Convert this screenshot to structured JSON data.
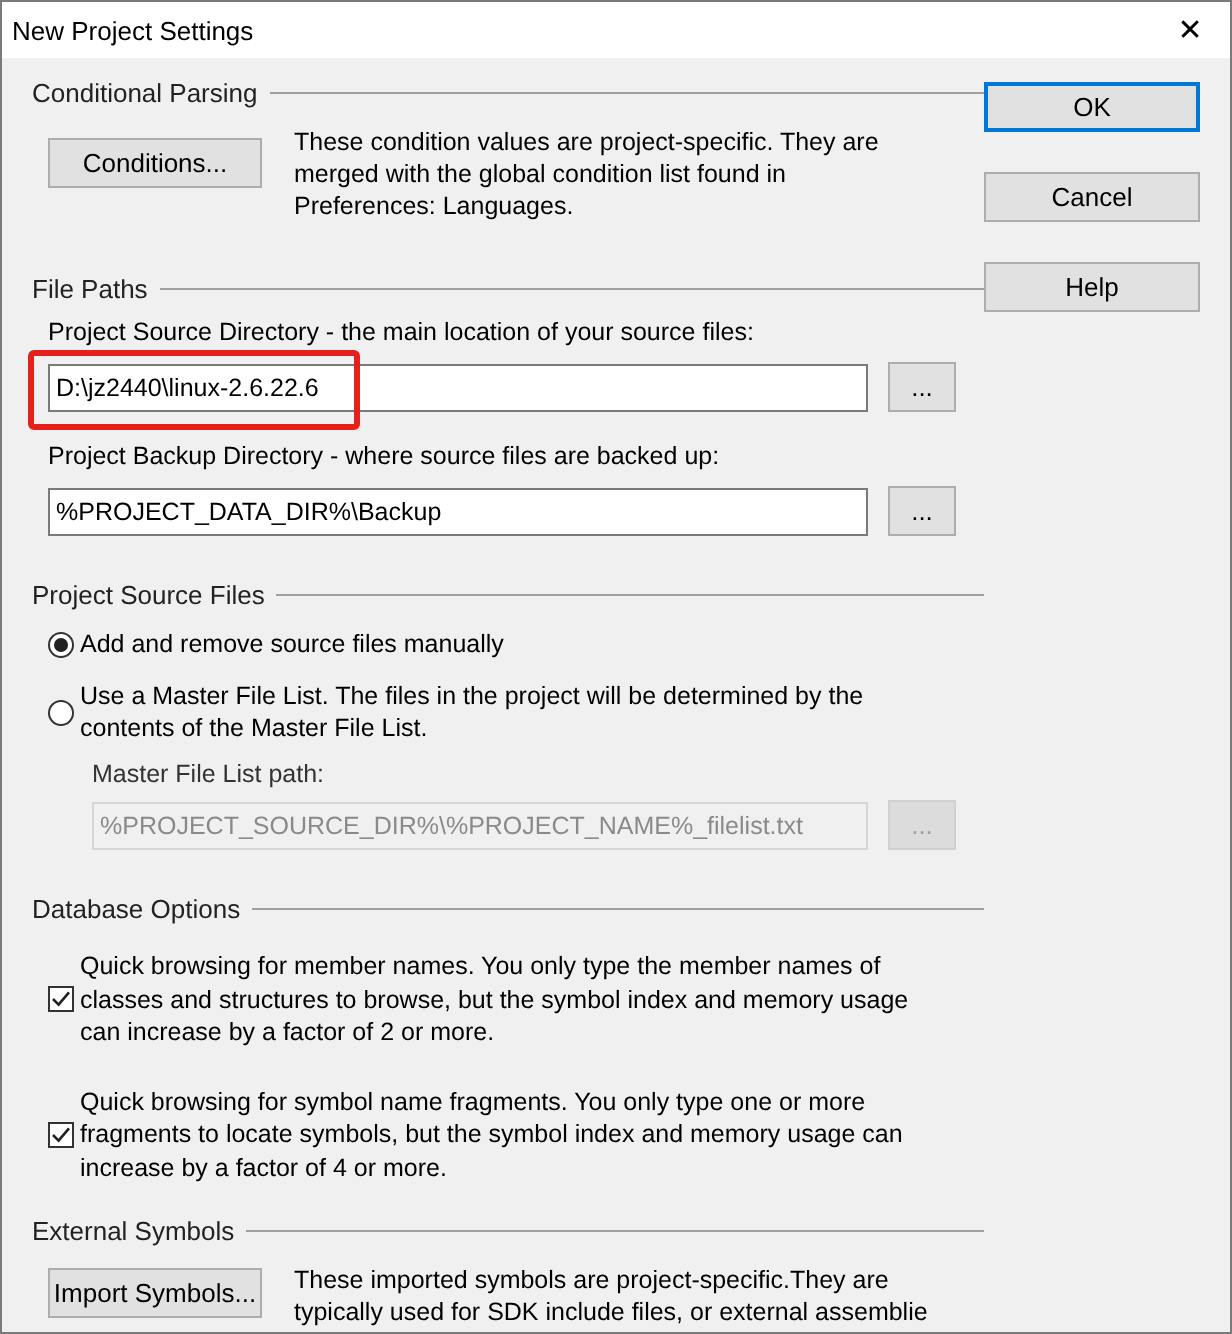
{
  "window": {
    "title": "New Project Settings",
    "close": "✕"
  },
  "buttons": [
    {
      "label": "OK",
      "default": true
    },
    {
      "label": "Cancel",
      "default": false
    },
    {
      "label": "Help",
      "default": false
    }
  ],
  "conditional_parsing": {
    "heading": "Conditional Parsing",
    "button": "Conditions...",
    "description": "These condition values are project-specific.  They are merged with the global condition list found in Preferences: Languages."
  },
  "file_paths": {
    "heading": "File Paths",
    "fields": [
      {
        "label": "Project Source Directory - the main location of your source files:",
        "value": "D:\\jz2440\\linux-2.6.22.6",
        "browse": "...",
        "highlighted": true
      },
      {
        "label": "Project Backup Directory - where source files are backed up:",
        "value": "%PROJECT_DATA_DIR%\\Backup",
        "browse": "...",
        "highlighted": false
      }
    ]
  },
  "project_source_files": {
    "heading": "Project Source Files",
    "options": [
      {
        "label": "Add and remove source files manually",
        "selected": true
      },
      {
        "label": "Use a Master File List. The files in the project will be determined by the contents of the Master File List.",
        "selected": false
      }
    ],
    "master_list": {
      "label": "Master File List path:",
      "value": "%PROJECT_SOURCE_DIR%\\%PROJECT_NAME%_filelist.txt",
      "browse": "...",
      "disabled": true
    }
  },
  "database_options": {
    "heading": "Database Options",
    "options": [
      {
        "label": "Quick browsing for member names.  You only type the member names of classes and structures to browse, but the symbol index and memory usage can increase by a factor of 2 or more.",
        "checked": true
      },
      {
        "label": "Quick browsing for symbol name fragments.  You only type one or more fragments to locate symbols, but the symbol index and memory usage can increase by a factor of 4 or more.",
        "checked": true
      }
    ]
  },
  "external_symbols": {
    "heading": "External Symbols",
    "button": "Import Symbols...",
    "description": "These imported symbols are project-specific.They are typically used for SDK include files, or external assemblie"
  }
}
